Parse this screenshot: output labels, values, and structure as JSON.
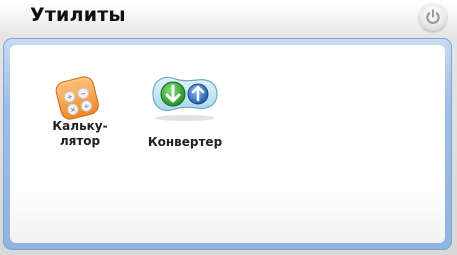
{
  "window": {
    "title": "Утилиты",
    "power_icon": "power-icon"
  },
  "apps": [
    {
      "label": "Кальку-\nлятор",
      "icon": "calculator-icon"
    },
    {
      "label": "Конвертер",
      "icon": "converter-icon"
    }
  ],
  "colors": {
    "panel_border": "#9fbfe4",
    "calculator": "#f39a3a",
    "converter_green": "#33a63a",
    "converter_blue": "#2f6fc4"
  }
}
